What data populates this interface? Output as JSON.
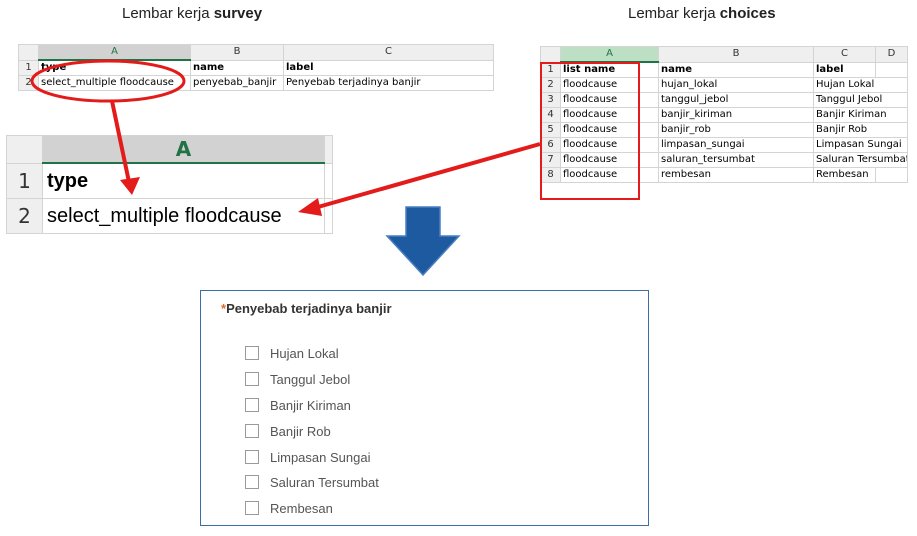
{
  "titles": {
    "survey_prefix": "Lembar kerja",
    "survey_bold": "survey",
    "choices_prefix": "Lembar kerja",
    "choices_bold": "choices"
  },
  "survey_sheet": {
    "columns": [
      "A",
      "B",
      "C"
    ],
    "rows": [
      {
        "num": "1",
        "cells": [
          "type",
          "name",
          "label"
        ]
      },
      {
        "num": "2",
        "cells": [
          "select_multiple floodcause",
          "penyebab_banjir",
          "Penyebab terjadinya banjir"
        ]
      }
    ]
  },
  "zoom_sheet": {
    "column": "A",
    "rows": [
      {
        "num": "1",
        "cell": "type"
      },
      {
        "num": "2",
        "cell": "select_multiple floodcause"
      }
    ]
  },
  "choices_sheet": {
    "columns": [
      "A",
      "B",
      "C",
      "D"
    ],
    "rows": [
      {
        "num": "1",
        "cells": [
          "list name",
          "name",
          "label"
        ]
      },
      {
        "num": "2",
        "cells": [
          "floodcause",
          "hujan_lokal",
          "Hujan Lokal"
        ]
      },
      {
        "num": "3",
        "cells": [
          "floodcause",
          "tanggul_jebol",
          "Tanggul Jebol"
        ]
      },
      {
        "num": "4",
        "cells": [
          "floodcause",
          "banjir_kiriman",
          "Banjir Kiriman"
        ]
      },
      {
        "num": "5",
        "cells": [
          "floodcause",
          "banjir_rob",
          "Banjir Rob"
        ]
      },
      {
        "num": "6",
        "cells": [
          "floodcause",
          "limpasan_sungai",
          "Limpasan Sungai"
        ]
      },
      {
        "num": "7",
        "cells": [
          "floodcause",
          "saluran_tersumbat",
          "Saluran Tersumbat"
        ]
      },
      {
        "num": "8",
        "cells": [
          "floodcause",
          "rembesan",
          "Rembesan"
        ]
      }
    ]
  },
  "form": {
    "required_mark": "*",
    "question": "Penyebab terjadinya banjir",
    "options": [
      "Hujan Lokal",
      "Tanggul Jebol",
      "Banjir Kiriman",
      "Banjir Rob",
      "Limpasan Sungai",
      "Saluran Tersumbat",
      "Rembesan"
    ]
  },
  "colors": {
    "highlight_red": "#e31b1b",
    "arrow_blue": "#1e5aa0",
    "excel_green": "#217346",
    "form_border": "#3a6ea5",
    "required_orange": "#e36b2c"
  }
}
